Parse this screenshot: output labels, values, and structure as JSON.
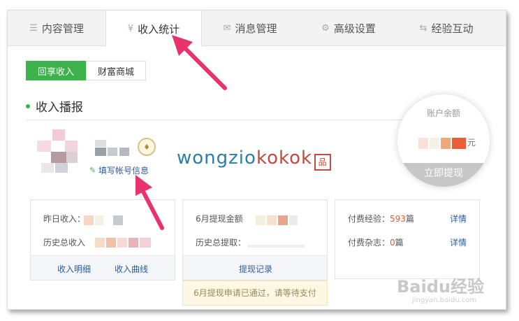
{
  "tabs": [
    {
      "label": "内容管理",
      "icon": "list-icon"
    },
    {
      "label": "收入统计",
      "icon": "yen-icon",
      "active": true
    },
    {
      "label": "消息管理",
      "icon": "mail-icon"
    },
    {
      "label": "高级设置",
      "icon": "gear-icon"
    },
    {
      "label": "经验互动",
      "icon": "exchange-icon"
    }
  ],
  "tab_icons": {
    "list": "☰",
    "yen": "¥",
    "mail": "✉",
    "gear": "⚙",
    "exchange": "⇆"
  },
  "segments": [
    "回享收入",
    "财富商城"
  ],
  "section_title": "收入播报",
  "profile": {
    "fill_info_link": "填写帐号信息"
  },
  "watermark": {
    "part1": "wongzio",
    "part2": "kokok"
  },
  "balance": {
    "label": "账户余额",
    "unit": "元",
    "withdraw_button": "立即提现"
  },
  "card1": {
    "yesterday_label": "昨日收入：",
    "total_label": "历史总收入",
    "link1": "收入明细",
    "link2": "收入曲线"
  },
  "card2": {
    "month_label": "6月提现金额",
    "total_label": "历史总提取：",
    "link": "提现记录",
    "notice": "6月提现申请已通过，请等待支付"
  },
  "card3": {
    "paid_exp_label": "付费经验：",
    "paid_exp_value": "593",
    "paid_exp_unit": "篇",
    "paid_mag_label": "付费杂志：",
    "paid_mag_value": "0",
    "paid_mag_unit": "篇",
    "detail": "详情"
  },
  "corner_watermark": {
    "brand": "Baidu经验",
    "url": "jingyan.baidu.com"
  },
  "colors": {
    "accent": "#3bb34a",
    "link": "#2a5aa6",
    "arrow": "#e8336d",
    "orange": "#e8572c"
  }
}
